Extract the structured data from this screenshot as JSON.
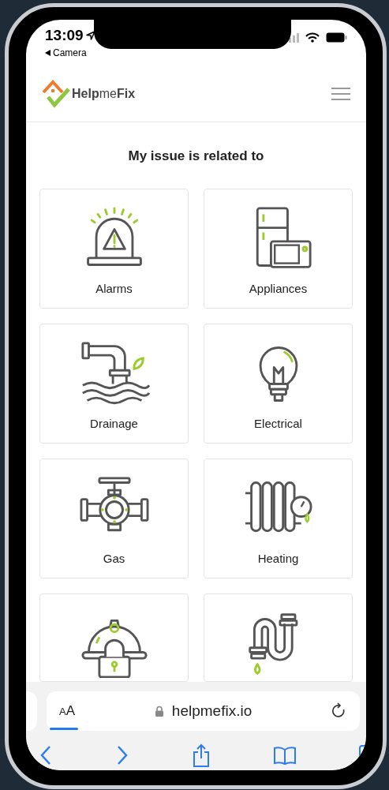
{
  "status_bar": {
    "time": "13:09",
    "back_label": "Camera"
  },
  "header": {
    "logo": "**Help**me**Fix**"
  },
  "heading": "My issue is related to",
  "categories": [
    {
      "kind": "alarm",
      "label": "Alarms"
    },
    {
      "kind": "appliances",
      "label": "Appliances"
    },
    {
      "kind": "drainage",
      "label": "Drainage"
    },
    {
      "kind": "electrical",
      "label": "Electrical"
    },
    {
      "kind": "gas",
      "label": "Gas"
    },
    {
      "kind": "heating",
      "label": "Heating"
    },
    {
      "kind": "locks"
    },
    {
      "kind": "plumbing"
    }
  ],
  "browser": {
    "text_size": "AA",
    "url": "helpmefix.io"
  }
}
